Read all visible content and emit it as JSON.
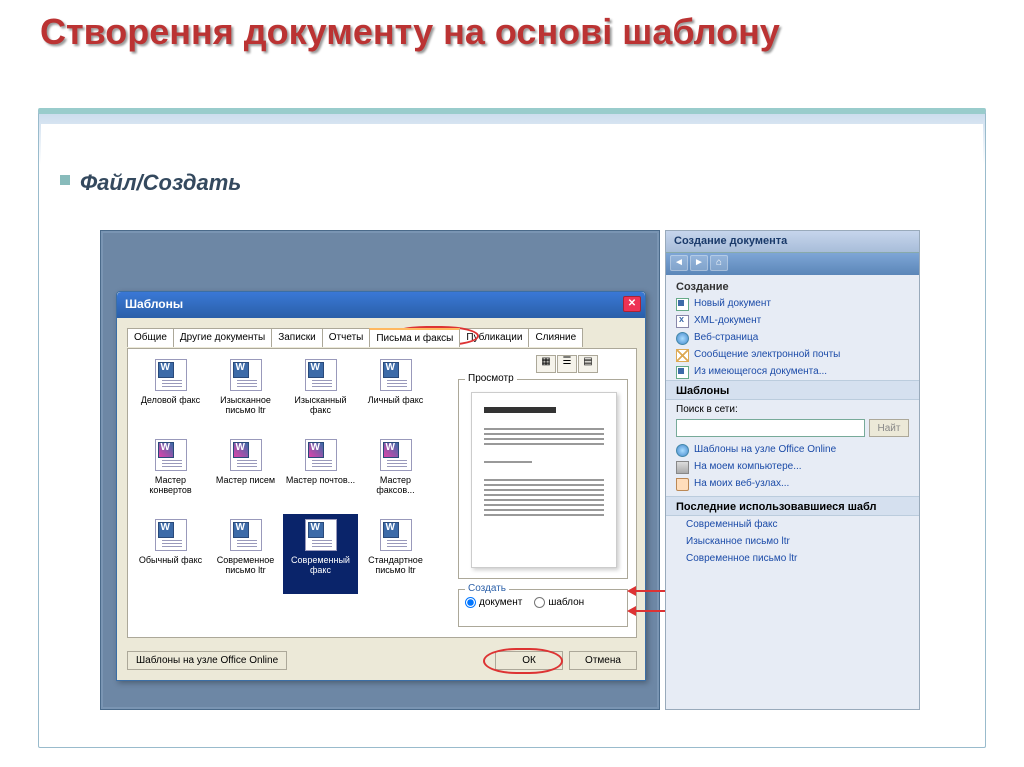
{
  "slide": {
    "title": "Створення документу на основі шаблону",
    "subtitle": "Файл/Создать"
  },
  "dialog": {
    "title": "Шаблоны",
    "tabs": [
      "Общие",
      "Другие документы",
      "Записки",
      "Отчеты",
      "Письма и факсы",
      "Публикации",
      "Слияние"
    ],
    "active_tab": 4,
    "templates": [
      "Деловой факс",
      "Изысканное письмо ltr",
      "Изысканный факс",
      "Личный факс",
      "Мастер конвертов",
      "Мастер писем",
      "Мастер почтов...",
      "Мастер факсов...",
      "Обычный факс",
      "Современное письмо ltr",
      "Современный факс",
      "Стандартное письмо ltr"
    ],
    "selected_index": 10,
    "preview_label": "Просмотр",
    "create_label": "Создать",
    "radio_document": "документ",
    "radio_template": "шаблон",
    "office_online_btn": "Шаблоны на узле Office Online",
    "ok": "ОК",
    "cancel": "Отмена"
  },
  "taskpane": {
    "title": "Создание документа",
    "section_create": "Создание",
    "items_create": [
      {
        "icon": "doc",
        "label": "Новый документ"
      },
      {
        "icon": "xml",
        "label": "XML-документ"
      },
      {
        "icon": "web",
        "label": "Веб-страница"
      },
      {
        "icon": "mail",
        "label": "Сообщение электронной почты"
      },
      {
        "icon": "doc",
        "label": "Из имеющегося документа..."
      }
    ],
    "section_templates": "Шаблоны",
    "search_placeholder": "Поиск в сети:",
    "search_btn": "Найт",
    "items_templates": [
      {
        "icon": "web",
        "label": "Шаблоны на узле Office Online"
      },
      {
        "icon": "computer",
        "label": "На моем компьютере..."
      },
      {
        "icon": "folder",
        "label": "На моих веб-узлах..."
      }
    ],
    "section_recent": "Последние использовавшиеся шабл",
    "recent": [
      "Современный факс",
      "Изысканное письмо ltr",
      "Современное письмо ltr"
    ]
  }
}
